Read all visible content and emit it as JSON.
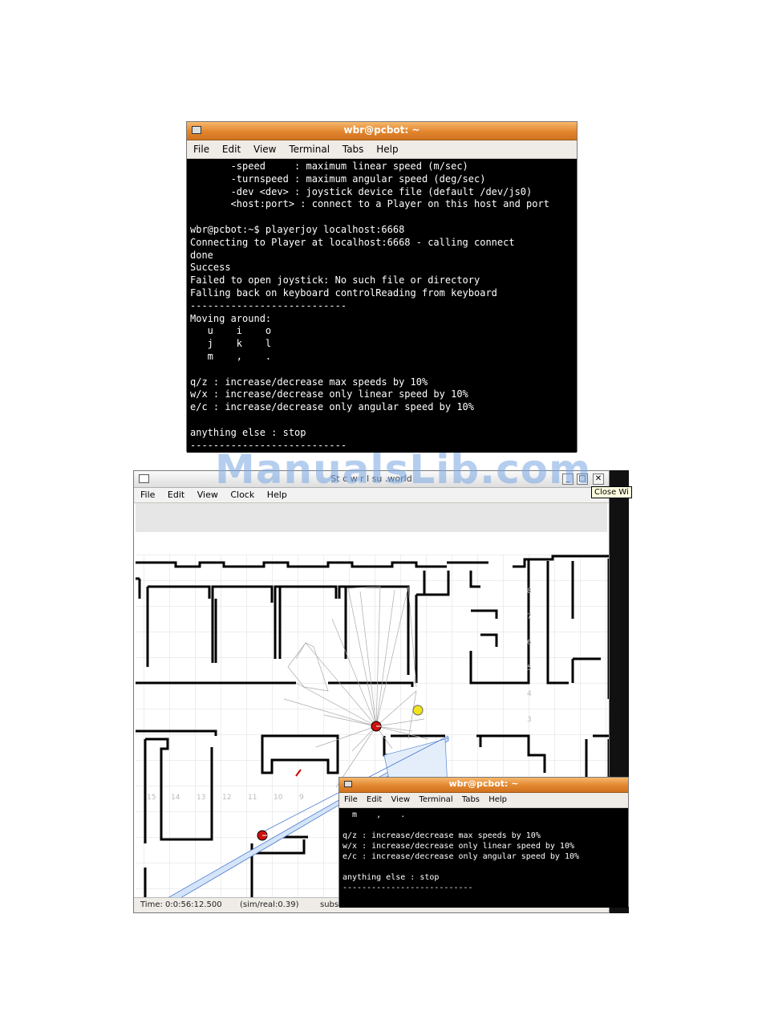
{
  "terminal_top": {
    "title": "wbr@pcbot: ~",
    "menu": [
      "File",
      "Edit",
      "View",
      "Terminal",
      "Tabs",
      "Help"
    ],
    "lines": [
      "       -speed     : maximum linear speed (m/sec)",
      "       -turnspeed : maximum angular speed (deg/sec)",
      "       -dev <dev> : joystick device file (default /dev/js0)",
      "       <host:port> : connect to a Player on this host and port",
      "",
      "wbr@pcbot:~$ playerjoy localhost:6668",
      "Connecting to Player at localhost:6668 - calling connect",
      "done",
      "Success",
      "Failed to open joystick: No such file or directory",
      "Falling back on keyboard controlReading from keyboard",
      "---------------------------",
      "Moving around:",
      "   u    i    o",
      "   j    k    l",
      "   m    ,    .",
      "",
      "q/z : increase/decrease max speeds by 10%",
      "w/x : increase/decrease only linear speed by 10%",
      "e/c : increase/decrease only angular speed by 10%",
      "",
      "anything else : stop",
      "---------------------------"
    ]
  },
  "stage": {
    "title": "St  c    w r  l  su  .world",
    "menu": [
      "File",
      "Edit",
      "View",
      "Clock",
      "Help"
    ],
    "buttons": {
      "minimize": "_",
      "maximize": "□",
      "close": "✕"
    },
    "tooltip": "Close Wi",
    "status": {
      "time": "Time: 0:0:56:12.500",
      "ratio": "(sim/real:0.39)",
      "subs": "subs"
    },
    "grid_labels_x": [
      "15",
      "14",
      "13",
      "12",
      "11",
      "10",
      "9"
    ],
    "grid_labels_y": [
      "8",
      "7",
      "6",
      "5",
      "4",
      "3"
    ]
  },
  "terminal_bottom": {
    "title": "wbr@pcbot: ~",
    "menu": [
      "File",
      "Edit",
      "View",
      "Terminal",
      "Tabs",
      "Help"
    ],
    "lines": [
      "  m    ,    .",
      "",
      "q/z : increase/decrease max speeds by 10%",
      "w/x : increase/decrease only linear speed by 10%",
      "e/c : increase/decrease only angular speed by 10%",
      "",
      "anything else : stop",
      "---------------------------"
    ]
  },
  "watermark": "ManualsLib.com",
  "colors": {
    "title_orange": "#e2862e",
    "robot_red": "#d01010",
    "robot_yellow": "#f2e41a",
    "laser_blue": "#bcd4f6"
  }
}
